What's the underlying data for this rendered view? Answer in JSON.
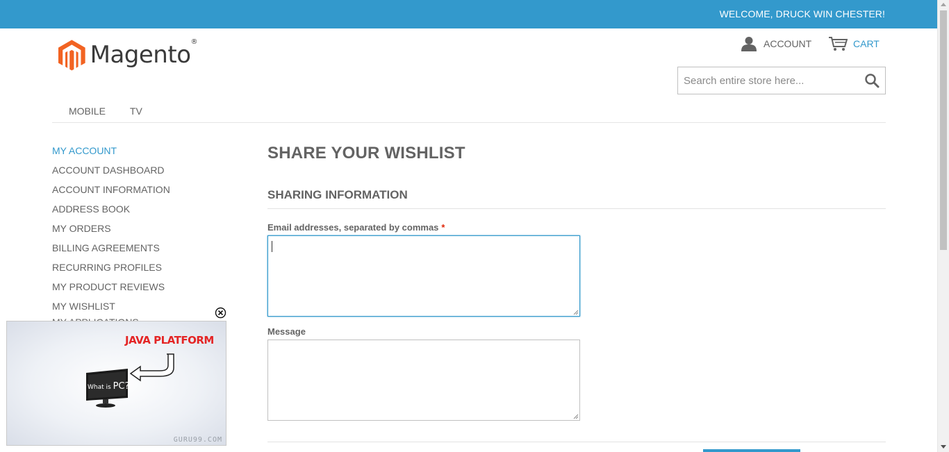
{
  "header": {
    "welcome": "WELCOME, DRUCK WIN CHESTER!",
    "logo_text": "Magento",
    "logo_reg": "®",
    "account_label": "ACCOUNT",
    "cart_label": "CART",
    "search_placeholder": "Search entire store here..."
  },
  "nav": {
    "items": [
      {
        "label": "MOBILE"
      },
      {
        "label": "TV"
      }
    ]
  },
  "sidebar": {
    "title": "MY ACCOUNT",
    "items": [
      {
        "label": "ACCOUNT DASHBOARD"
      },
      {
        "label": "ACCOUNT INFORMATION"
      },
      {
        "label": "ADDRESS BOOK"
      },
      {
        "label": "MY ORDERS"
      },
      {
        "label": "BILLING AGREEMENTS"
      },
      {
        "label": "RECURRING PROFILES"
      },
      {
        "label": "MY PRODUCT REVIEWS"
      },
      {
        "label": "MY WISHLIST"
      },
      {
        "label": "MY APPLICATIONS"
      }
    ]
  },
  "main": {
    "page_title": "SHARE YOUR WISHLIST",
    "section_title": "SHARING INFORMATION",
    "emails_label": "Email addresses, separated by commas",
    "required_mark": "*",
    "emails_value": "",
    "message_label": "Message",
    "message_value": ""
  },
  "video_popup": {
    "heading": "JAVA PLATFORM",
    "screen_text_small": "What is ",
    "screen_text_big": "PC?",
    "watermark": "GURU99.COM"
  },
  "colors": {
    "accent": "#3399cc",
    "brand_orange": "#f26322",
    "required": "#df280a"
  },
  "icons": {
    "account": "user-icon",
    "cart": "cart-icon",
    "search": "search-icon",
    "close": "close-circle-icon"
  }
}
